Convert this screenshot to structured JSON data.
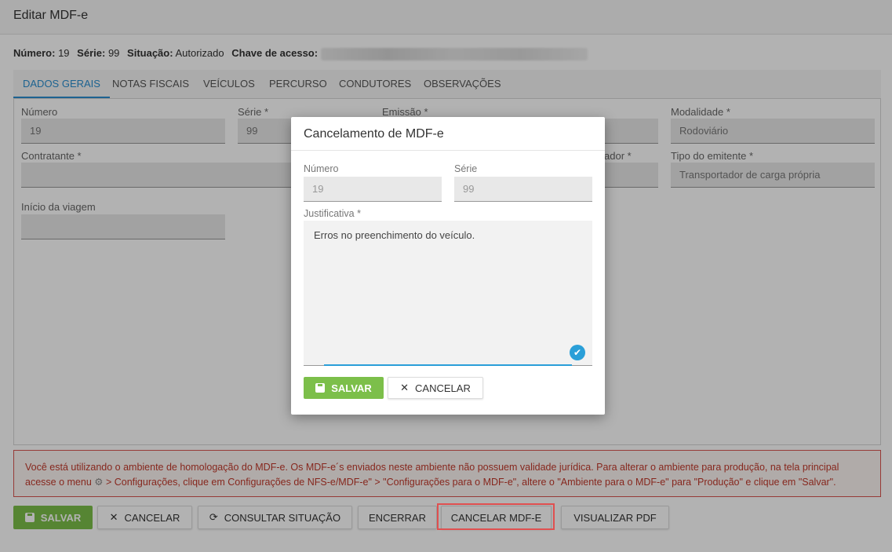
{
  "window": {
    "title": "Editar MDF-e"
  },
  "info": {
    "numero_label": "Número:",
    "numero_value": "19",
    "serie_label": "Série:",
    "serie_value": "99",
    "situacao_label": "Situação:",
    "situacao_value": "Autorizado",
    "chave_label": "Chave de acesso:"
  },
  "tabs": [
    "DADOS GERAIS",
    "NOTAS FISCAIS",
    "VEÍCULOS",
    "PERCURSO",
    "CONDUTORES",
    "OBSERVAÇÕES"
  ],
  "form": {
    "numero_label": "Número",
    "numero_value": "19",
    "serie_label": "Série *",
    "serie_value": "99",
    "emissao_label": "Emissão *",
    "modalidade_label": "Modalidade *",
    "modalidade_value": "Rodoviário",
    "contratante_label": "Contratante *",
    "ador_label": "ador *",
    "tipo_emitente_label": "Tipo do emitente *",
    "tipo_emitente_value": "Transportador de carga própria",
    "inicio_viagem_label": "Início da viagem"
  },
  "warning": {
    "line1": "Você está utilizando o ambiente de homologação do MDF-e. Os MDF-e´s enviados neste ambiente não possuem validade jurídica. Para alterar o ambiente para produção, na tela principal",
    "line2_a": "acesse o menu",
    "line2_b": "> Configurações, clique em Configurações de NFS-e/MDF-e\" > \"Configurações para o MDF-e\", altere o \"Ambiente para o MDF-e\" para \"Produção\" e clique em \"Salvar\"."
  },
  "footer_buttons": {
    "salvar": "SALVAR",
    "cancelar": "CANCELAR",
    "consultar": "CONSULTAR SITUAÇÃO",
    "encerrar": "ENCERRAR",
    "cancelar_mdfe": "CANCELAR MDF-E",
    "visualizar_pdf": "VISUALIZAR PDF"
  },
  "modal": {
    "title": "Cancelamento de MDF-e",
    "numero_label": "Número",
    "numero_value": "19",
    "serie_label": "Série",
    "serie_value": "99",
    "justificativa_label": "Justificativa *",
    "justificativa_value": "Erros no preenchimento do veículo.",
    "salvar": "SALVAR",
    "cancelar": "CANCELAR"
  },
  "colors": {
    "accent": "#2a8fd0",
    "green": "#7cbf4a",
    "warning": "#c0392b",
    "highlight": "#e05050"
  }
}
